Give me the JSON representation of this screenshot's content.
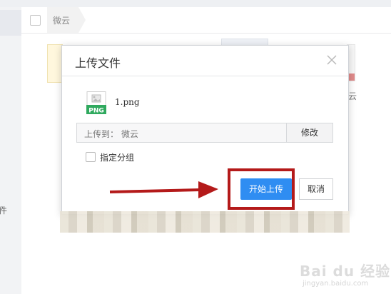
{
  "background": {
    "breadcrumb": "微云",
    "side_label": "件",
    "right_label": "云"
  },
  "dialog": {
    "title": "上传文件",
    "file": {
      "name": "1.png",
      "type_badge": "PNG",
      "icon": "png-file-icon"
    },
    "destination": {
      "label": "上传到：",
      "value": "微云",
      "modify_button": "修改"
    },
    "group_option": {
      "label": "指定分组",
      "checked": false
    },
    "buttons": {
      "start_upload": "开始上传",
      "cancel": "取消"
    }
  },
  "watermark": {
    "brand": "Bai du 经验",
    "url": "jingyan.baidu.com"
  },
  "colors": {
    "primary_button": "#2f8df2",
    "annotation_red": "#b41a1a",
    "badge_green": "#2fa95e"
  }
}
